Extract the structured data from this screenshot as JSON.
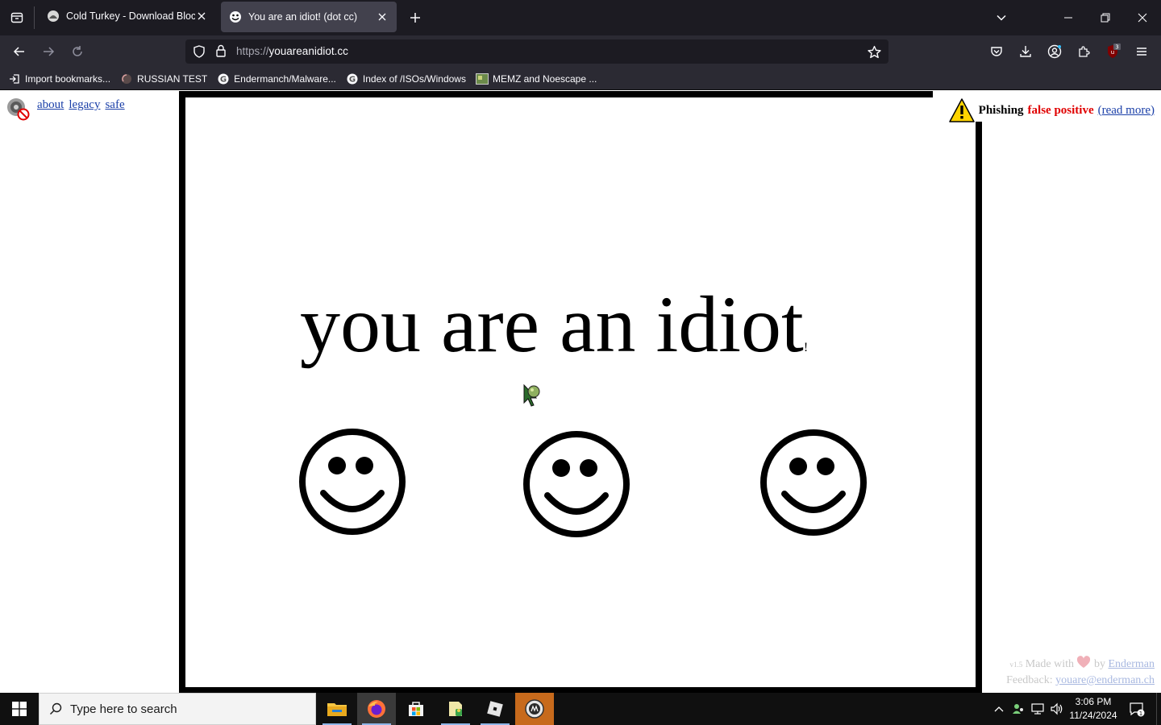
{
  "browser": {
    "tabs": [
      {
        "title": "Cold Turkey - Download Blocke",
        "favicon": "cold-turkey-icon",
        "active": false
      },
      {
        "title": "You are an idiot! (dot cc)",
        "favicon": "smiley-favicon-icon",
        "active": true
      }
    ],
    "url": {
      "protocol": "https://",
      "host": "youareanidiot.cc"
    },
    "bookmarks": [
      {
        "label": "Import bookmarks...",
        "icon": "import-icon"
      },
      {
        "label": "RUSSIAN TEST",
        "icon": "globe-icon"
      },
      {
        "label": "Endermanch/Malware...",
        "icon": "google-icon"
      },
      {
        "label": "Index of /ISOs/Windows",
        "icon": "google-icon"
      },
      {
        "label": "MEMZ and Noescape ...",
        "icon": "image-icon"
      }
    ],
    "extension_badge": "3"
  },
  "page": {
    "nav_links": [
      "about",
      "legacy",
      "safe"
    ],
    "phishing": {
      "label": "Phishing",
      "status": "false positive",
      "link": "(read more)"
    },
    "headline": "you are an idiot",
    "headline_suffix": "!",
    "smileys": 3,
    "footer": {
      "version": "v1.5",
      "made_with": "Made with",
      "by": "by",
      "author": "Enderman",
      "feedback_label": "Feedback:",
      "feedback_email": "youare@enderman.ch"
    }
  },
  "taskbar": {
    "search_placeholder": "Type here to search",
    "time": "3:06 PM",
    "date": "11/24/2024",
    "notification_count": "1"
  },
  "colors": {
    "tab_bar_bg": "#1c1b22",
    "toolbar_bg": "#2b2a33",
    "link_blue": "#1a3fa8",
    "warning_red": "#e00000",
    "cold_turkey_orange": "#c76a1c"
  }
}
